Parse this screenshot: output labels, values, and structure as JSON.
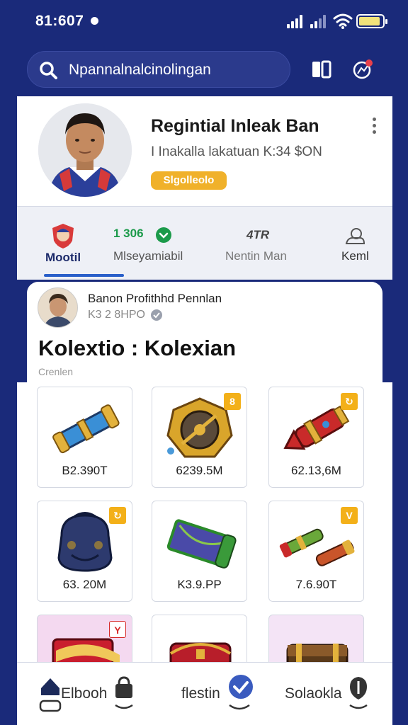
{
  "status_bar": {
    "time": "81:607"
  },
  "search": {
    "text": "Npannalnalcinolingan"
  },
  "profile": {
    "name": "Regintial Inleak Ban",
    "subtitle": "I Inakalla lakatuan K:34 $ON",
    "badge": "Slgolleolo"
  },
  "tabs": [
    {
      "label": "Mootil",
      "value": ""
    },
    {
      "label": "Mlseyamiabil",
      "value": "1 306"
    },
    {
      "label": "Nentin Man",
      "value": "4TR"
    },
    {
      "label": "Keml",
      "value": ""
    }
  ],
  "content": {
    "name": "Banon Profithhd Pennlan",
    "subtitle": "K3 2 8HPO",
    "collection_title": "Kolextio  :  Kolexian",
    "collection_sub": "Crenlen"
  },
  "items": [
    {
      "price": "B2.390T",
      "tag": "",
      "icon": "blue-cannon"
    },
    {
      "price": "6239.5M",
      "tag": "8",
      "icon": "golden-shield-wheel"
    },
    {
      "price": "62.13,6M",
      "tag": "↻",
      "icon": "red-rocket"
    },
    {
      "price": "63. 20M",
      "tag": "↻",
      "icon": "dark-backpack"
    },
    {
      "price": "K3.9.PP",
      "tag": "",
      "icon": "green-scroll"
    },
    {
      "price": "7.6.90T",
      "tag": "V",
      "icon": "twin-pistons"
    },
    {
      "price": "",
      "tag": "Y",
      "icon": "red-gift-box"
    },
    {
      "price": "",
      "tag": "",
      "icon": "red-chest"
    },
    {
      "price": "",
      "tag": "",
      "icon": "brown-chest"
    }
  ],
  "bottom_nav": [
    {
      "label": "Elbooh",
      "icon": "home-icon"
    },
    {
      "label": "flestin",
      "icon": "check-badge-icon"
    },
    {
      "label": "Solaokla",
      "icon": "shield-icon"
    }
  ],
  "colors": {
    "background": "#1a2a7a",
    "accent": "#2a5fc9",
    "badge": "#f0b12a",
    "positive": "#1b9a4a"
  }
}
